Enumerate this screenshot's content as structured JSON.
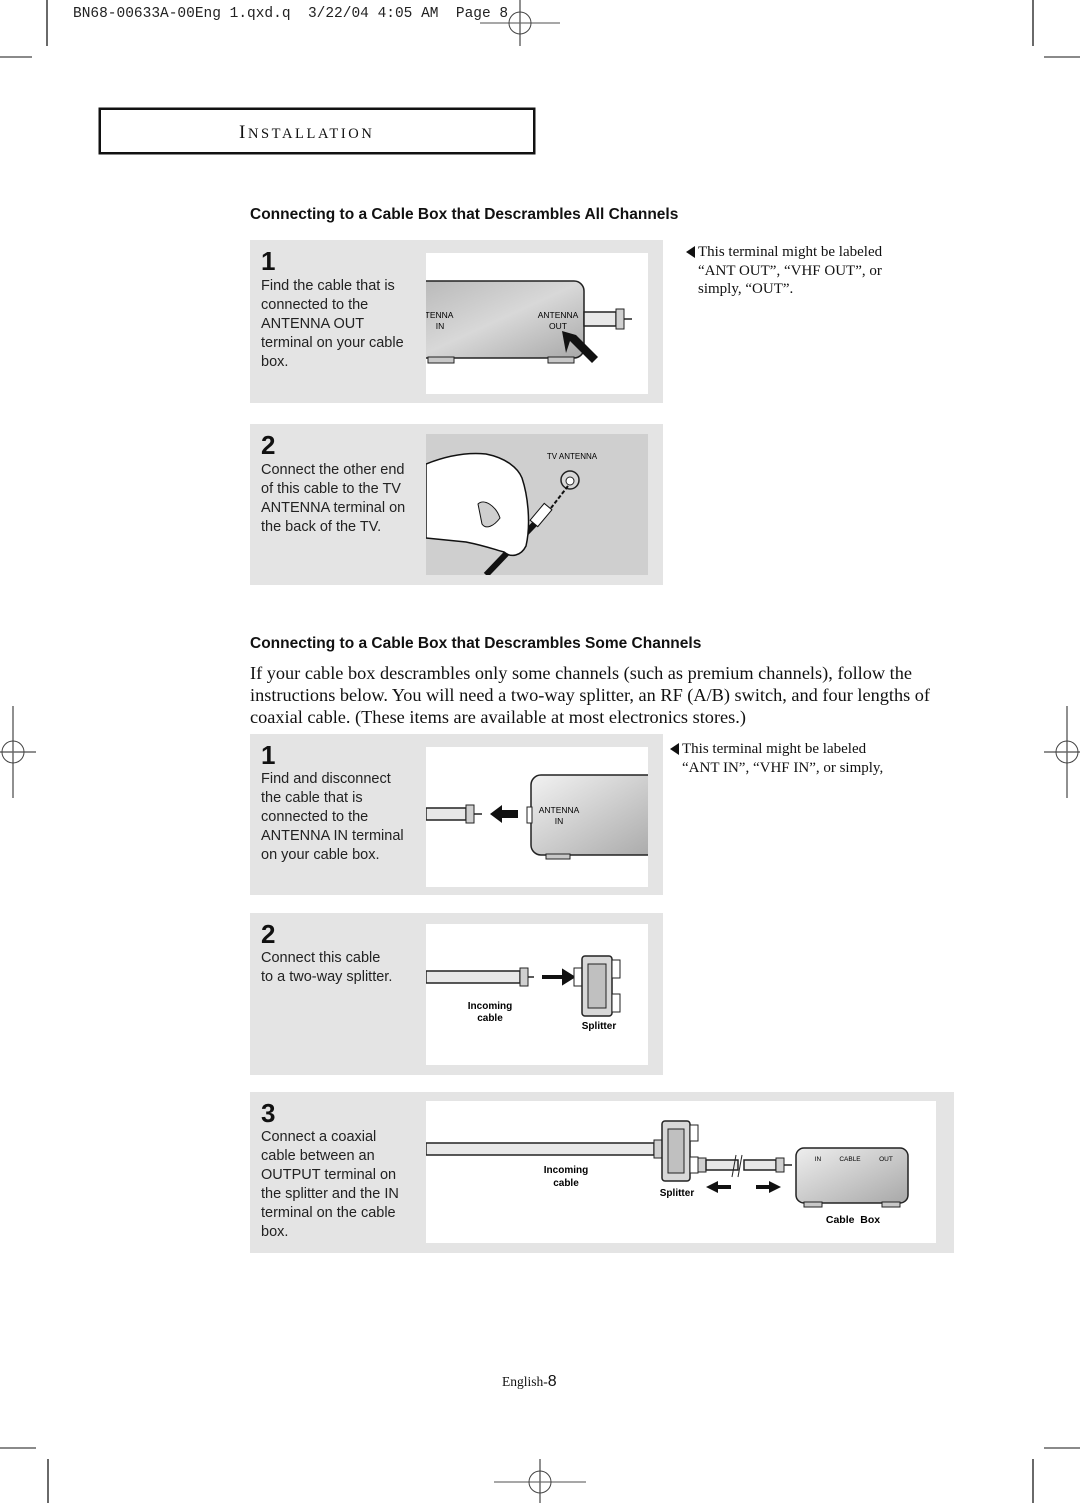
{
  "slug": {
    "filename": "BN68-00633A-00Eng 1.qxd.q",
    "date": "3/22/04",
    "time": "4:05 AM",
    "page_label": "Page",
    "page_number": "8"
  },
  "section": {
    "title_first": "I",
    "title_rest": "NSTALLATION"
  },
  "all_channels": {
    "heading": "Connecting to a Cable Box that Descrambles All Channels",
    "steps": [
      {
        "number": "1",
        "lines": [
          "Find the cable that is",
          "connected to the",
          "ANTENNA OUT",
          "terminal on your cable",
          "box."
        ],
        "diagram": {
          "label_in_1": "NTENNA",
          "label_in_2": "IN",
          "label_out_1": "ANTENNA",
          "label_out_2": "OUT"
        }
      },
      {
        "number": "2",
        "lines": [
          "Connect the other end",
          "of this cable to the TV",
          "ANTENNA terminal on",
          "the back of the TV."
        ],
        "diagram": {
          "label": "TV ANTENNA"
        }
      }
    ],
    "note": [
      "This terminal might be labeled",
      "“ANT OUT”, “VHF OUT”, or",
      "simply, “OUT”."
    ]
  },
  "some_channels": {
    "heading": "Connecting to a Cable Box that Descrambles Some Channels",
    "intro": "If your cable box descrambles only some channels (such as premium channels), follow the instructions below. You will need a two-way splitter, an RF (A/B) switch, and four lengths of coaxial cable. (These items are available at most electronics stores.)",
    "steps": [
      {
        "number": "1",
        "lines": [
          "Find and disconnect",
          "the cable that is",
          "connected to the",
          "ANTENNA IN terminal",
          "on your cable box."
        ],
        "diagram": {
          "label_1": "ANTENNA",
          "label_2": "IN"
        }
      },
      {
        "number": "2",
        "lines": [
          "Connect this cable",
          "to a two-way splitter."
        ],
        "diagram": {
          "incoming_1": "Incoming",
          "incoming_2": "cable",
          "splitter": "Splitter"
        }
      },
      {
        "number": "3",
        "lines": [
          "Connect a coaxial",
          "cable between an",
          "OUTPUT terminal on",
          "the splitter and the IN",
          "terminal on the cable",
          "box."
        ],
        "diagram": {
          "incoming_1": "Incoming",
          "incoming_2": "cable",
          "splitter": "Splitter",
          "box_in": "IN",
          "box_cable": "CABLE",
          "box_out": "OUT",
          "box_label": "Cable  Box"
        }
      }
    ],
    "note": [
      "This terminal might be labeled",
      "“ANT IN”, “VHF IN”, or simply,"
    ]
  },
  "footer": {
    "prefix": "English-",
    "page": "8"
  }
}
